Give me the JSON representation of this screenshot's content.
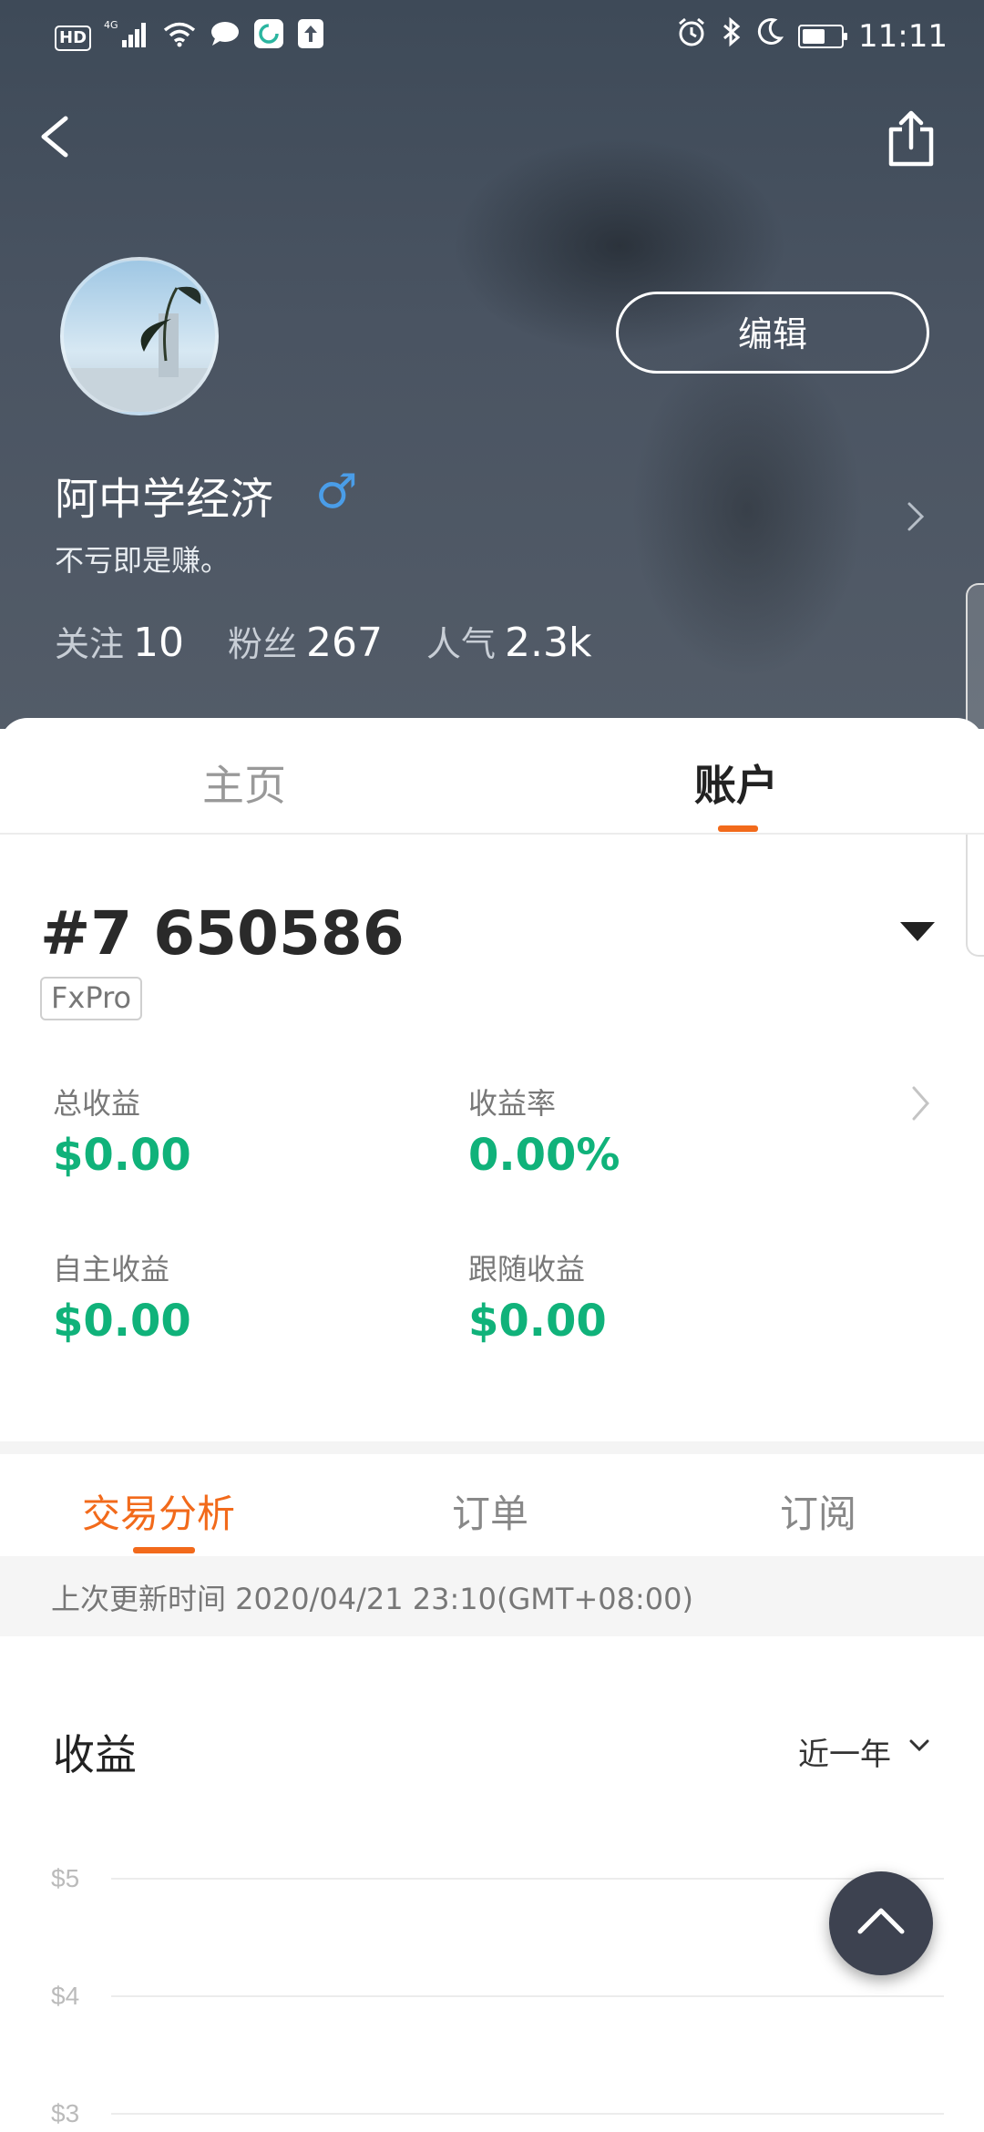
{
  "status_bar": {
    "network_type": "4G",
    "hd_label": "HD",
    "time": "11:11"
  },
  "header": {
    "edit_label": "编辑",
    "username": "阿中学经济",
    "gender_symbol": "♂",
    "bio": "不亏即是赚。",
    "stats": [
      {
        "label": "关注",
        "value": "10"
      },
      {
        "label": "粉丝",
        "value": "267"
      },
      {
        "label": "人气",
        "value": "2.3k"
      }
    ]
  },
  "main_tabs": {
    "home": "主页",
    "account": "账户"
  },
  "account": {
    "number": "#7 650586",
    "broker": "FxPro",
    "metrics": {
      "total_profit_label": "总收益",
      "total_profit_value": "$0.00",
      "return_rate_label": "收益率",
      "return_rate_value": "0.00%",
      "self_profit_label": "自主收益",
      "self_profit_value": "$0.00",
      "follow_profit_label": "跟随收益",
      "follow_profit_value": "$0.00"
    }
  },
  "sub_tabs": {
    "analysis": "交易分析",
    "orders": "订单",
    "subscriptions": "订阅"
  },
  "update_text": "上次更新时间 2020/04/21 23:10(GMT+08:00)",
  "chart_section": {
    "title": "收益",
    "range": "近一年"
  },
  "chart_data": {
    "type": "line",
    "title": "收益",
    "y_ticks": [
      "$5",
      "$4",
      "$3"
    ],
    "y_tick_values": [
      5,
      4,
      3
    ],
    "ylim": [
      3,
      5
    ],
    "grid": true,
    "series": []
  },
  "colors": {
    "accent": "#f26a1b",
    "profit_green": "#10b27a",
    "gender_blue": "#4a9de8"
  }
}
